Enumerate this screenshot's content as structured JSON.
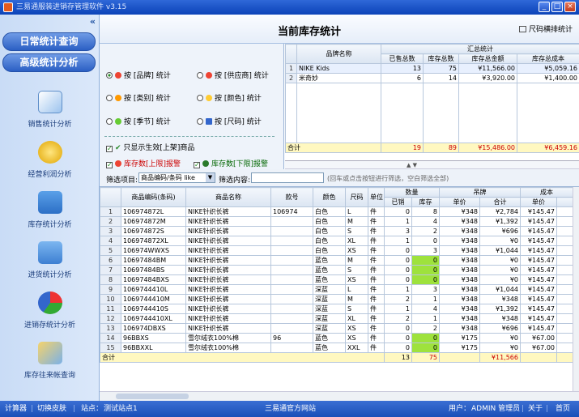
{
  "window": {
    "title": "三易通服装进销存管理软件  v3.15"
  },
  "sidebar": {
    "top_buttons": [
      "日常统计查询",
      "高级统计分析"
    ],
    "items": [
      {
        "label": "销售统计分析",
        "icon": "sales-chart-icon"
      },
      {
        "label": "经营利润分析",
        "icon": "coins-icon"
      },
      {
        "label": "库存统计分析",
        "icon": "warehouse-icon"
      },
      {
        "label": "进货统计分析",
        "icon": "inbound-icon"
      },
      {
        "label": "进销存统计分析",
        "icon": "pie-chart-icon"
      },
      {
        "label": "库存往来帐查询",
        "icon": "ledger-icon"
      }
    ]
  },
  "header": {
    "title": "当前库存统计",
    "size_button": "尺码横排统计"
  },
  "options": {
    "radios": [
      "按 [品牌] 统计",
      "按 [供应商] 统计",
      "按 [类别] 统计",
      "按 [颜色] 统计",
      "按 [季节] 统计",
      "按 [尺码] 统计"
    ],
    "selected": 0,
    "only_active": "只显示生效[上架]商品",
    "upper_alert": "库存数[上限]报警",
    "lower_alert": "库存数[下限]报警"
  },
  "summary": {
    "group_header": "汇总统计",
    "columns": [
      "品牌名称",
      "已售总数",
      "库存总数",
      "库存总金额",
      "库存总成本"
    ],
    "rows": [
      {
        "idx": "1",
        "name": "NIKE Kids",
        "sold": "13",
        "stock": "75",
        "amount": "¥11,566.00",
        "cost": "¥5,059.16"
      },
      {
        "idx": "2",
        "name": "米奇妙",
        "sold": "6",
        "stock": "14",
        "amount": "¥3,920.00",
        "cost": "¥1,400.00"
      }
    ],
    "total": {
      "label": "合计",
      "sold": "19",
      "stock": "89",
      "amount": "¥15,486.00",
      "cost": "¥6,459.16"
    }
  },
  "filter": {
    "label": "筛选项目:",
    "selected": "商品编码/条码 like",
    "content_label": "筛选内容:",
    "content_value": "",
    "hint": "(回车或点击按钮进行筛选，空白筛选全部)"
  },
  "grid": {
    "headers": {
      "code": "商品编码(条码)",
      "name": "商品名称",
      "style": "款号",
      "color": "颜色",
      "size": "尺码",
      "unit": "单位",
      "qty": "数量",
      "sold": "已销",
      "stock": "库存",
      "tag": "吊牌",
      "price": "单价",
      "total": "合计",
      "cost": "成本",
      "cprice": "单价"
    },
    "rows": [
      {
        "idx": "1",
        "code": "106974872L",
        "name": "NIKE针织长裤",
        "style": "106974",
        "color": "白色",
        "size": "L",
        "unit": "件",
        "sold": "0",
        "stock": "8",
        "price": "¥348",
        "total": "¥2,784",
        "cost": "¥145.47",
        "green": false
      },
      {
        "idx": "2",
        "code": "106974872M",
        "name": "NIKE针织长裤",
        "style": "",
        "color": "白色",
        "size": "M",
        "unit": "件",
        "sold": "1",
        "stock": "4",
        "price": "¥348",
        "total": "¥1,392",
        "cost": "¥145.47",
        "green": false
      },
      {
        "idx": "3",
        "code": "106974872S",
        "name": "NIKE针织长裤",
        "style": "",
        "color": "白色",
        "size": "S",
        "unit": "件",
        "sold": "3",
        "stock": "2",
        "price": "¥348",
        "total": "¥696",
        "cost": "¥145.47",
        "green": false
      },
      {
        "idx": "4",
        "code": "106974872XL",
        "name": "NIKE针织长裤",
        "style": "",
        "color": "白色",
        "size": "XL",
        "unit": "件",
        "sold": "1",
        "stock": "0",
        "price": "¥348",
        "total": "¥0",
        "cost": "¥145.47",
        "green": false
      },
      {
        "idx": "5",
        "code": "106974WWXS",
        "name": "NIKE针织长裤",
        "style": "",
        "color": "白色",
        "size": "XS",
        "unit": "件",
        "sold": "0",
        "stock": "3",
        "price": "¥348",
        "total": "¥1,044",
        "cost": "¥145.47",
        "green": false
      },
      {
        "idx": "6",
        "code": "10697484BM",
        "name": "NIKE针织长裤",
        "style": "",
        "color": "蓝色",
        "size": "M",
        "unit": "件",
        "sold": "0",
        "stock": "0",
        "price": "¥348",
        "total": "¥0",
        "cost": "¥145.47",
        "green": true
      },
      {
        "idx": "7",
        "code": "10697484BS",
        "name": "NIKE针织长裤",
        "style": "",
        "color": "蓝色",
        "size": "S",
        "unit": "件",
        "sold": "0",
        "stock": "0",
        "price": "¥348",
        "total": "¥0",
        "cost": "¥145.47",
        "green": true
      },
      {
        "idx": "8",
        "code": "10697484BXS",
        "name": "NIKE针织长裤",
        "style": "",
        "color": "蓝色",
        "size": "XS",
        "unit": "件",
        "sold": "0",
        "stock": "0",
        "price": "¥348",
        "total": "¥0",
        "cost": "¥145.47",
        "green": true
      },
      {
        "idx": "9",
        "code": "1069744410L",
        "name": "NIKE针织长裤",
        "style": "",
        "color": "深蓝",
        "size": "L",
        "unit": "件",
        "sold": "1",
        "stock": "3",
        "price": "¥348",
        "total": "¥1,044",
        "cost": "¥145.47",
        "green": false
      },
      {
        "idx": "10",
        "code": "1069744410M",
        "name": "NIKE针织长裤",
        "style": "",
        "color": "深蓝",
        "size": "M",
        "unit": "件",
        "sold": "2",
        "stock": "1",
        "price": "¥348",
        "total": "¥348",
        "cost": "¥145.47",
        "green": false
      },
      {
        "idx": "11",
        "code": "1069744410S",
        "name": "NIKE针织长裤",
        "style": "",
        "color": "深蓝",
        "size": "S",
        "unit": "件",
        "sold": "1",
        "stock": "4",
        "price": "¥348",
        "total": "¥1,392",
        "cost": "¥145.47",
        "green": false
      },
      {
        "idx": "12",
        "code": "1069744410XL",
        "name": "NIKE针织长裤",
        "style": "",
        "color": "深蓝",
        "size": "XL",
        "unit": "件",
        "sold": "2",
        "stock": "1",
        "price": "¥348",
        "total": "¥348",
        "cost": "¥145.47",
        "green": false
      },
      {
        "idx": "13",
        "code": "106974DBXS",
        "name": "NIKE针织长裤",
        "style": "",
        "color": "深蓝",
        "size": "XS",
        "unit": "件",
        "sold": "0",
        "stock": "2",
        "price": "¥348",
        "total": "¥696",
        "cost": "¥145.47",
        "green": false
      },
      {
        "idx": "14",
        "code": "96BBXS",
        "name": "雪尔绒衣100%棉",
        "style": "96",
        "color": "蓝色",
        "size": "XS",
        "unit": "件",
        "sold": "0",
        "stock": "0",
        "price": "¥175",
        "total": "¥0",
        "cost": "¥67.00",
        "green": true
      },
      {
        "idx": "15",
        "code": "96BBXXL",
        "name": "雪尔绒衣100%棉",
        "style": "",
        "color": "蓝色",
        "size": "XXL",
        "unit": "件",
        "sold": "0",
        "stock": "0",
        "price": "¥175",
        "total": "¥0",
        "cost": "¥67.00",
        "green": true
      }
    ],
    "total": {
      "label": "合计",
      "sold": "13",
      "stock": "75",
      "total": "¥11,566"
    }
  },
  "statusbar": {
    "calc": "计算器",
    "skin": "切换皮肤",
    "site_label": "站点：",
    "site": "测试站点1",
    "website": "三易通官方网站",
    "user_label": "用户：",
    "user": "ADMIN 管理员",
    "about": "关于",
    "home": "首页"
  }
}
